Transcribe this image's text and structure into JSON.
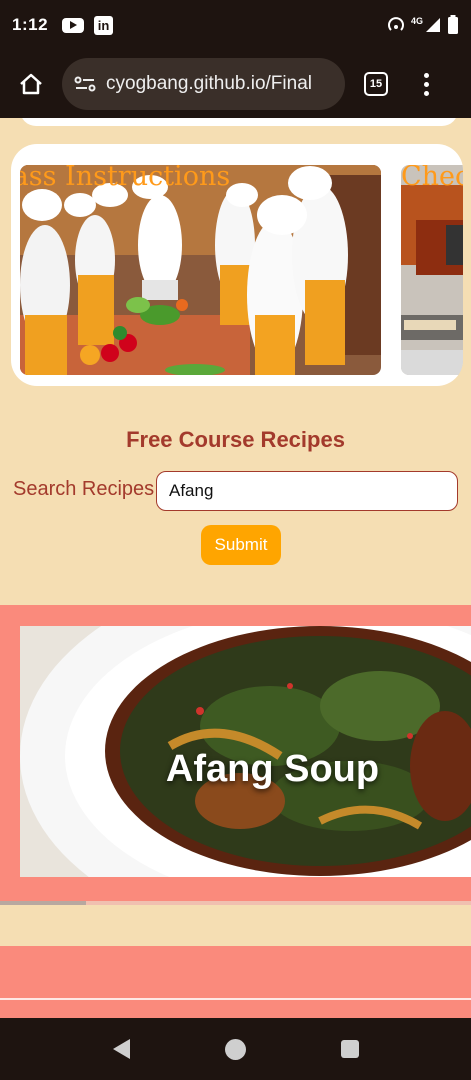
{
  "status_bar": {
    "time": "1:12",
    "network": "4G",
    "icons": [
      "youtube-icon",
      "linkedin-icon",
      "hotspot-icon",
      "signal-icon",
      "battery-icon"
    ]
  },
  "browser": {
    "url": "cyogbang.github.io/Final",
    "tab_count": "15",
    "linkedin_letters": "in"
  },
  "carousel": {
    "slides": [
      {
        "caption": "lass Instructions"
      },
      {
        "caption": "Chec"
      }
    ]
  },
  "recipes": {
    "title": "Free Course Recipes",
    "search_label": "Search Recipes",
    "search_value": "Afang",
    "submit_label": "Submit"
  },
  "result": {
    "title": "Afang Soup"
  },
  "colors": {
    "page_bg": "#f5deb3",
    "accent_red": "#a33a2c",
    "submit_orange": "#ffa500",
    "band_salmon": "#fa8a7c",
    "caption_orange": "#ff9a1a",
    "system_bar": "#1e1410"
  }
}
